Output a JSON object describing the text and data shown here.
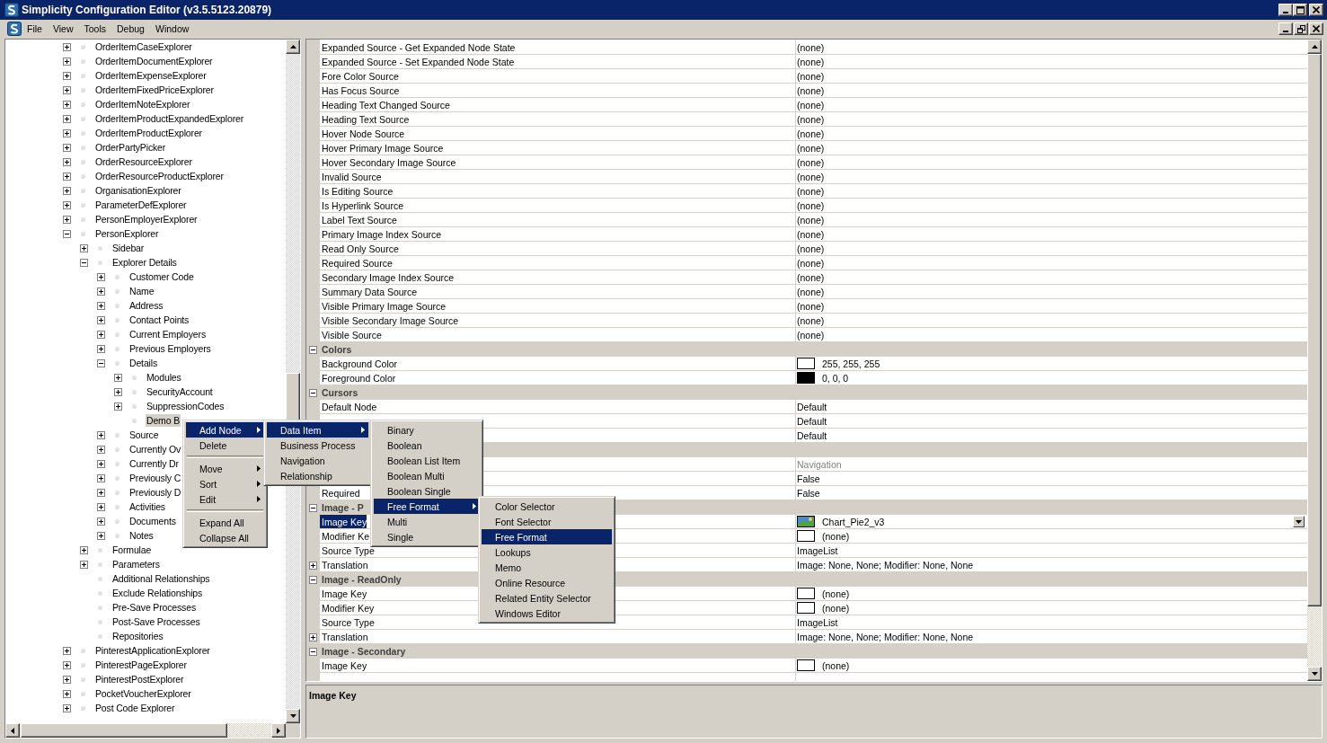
{
  "window": {
    "title": "Simplicity Configuration Editor (v3.5.5123.20879)"
  },
  "menu_bar": {
    "items": [
      "File",
      "View",
      "Tools",
      "Debug",
      "Window"
    ]
  },
  "tree": {
    "items": [
      {
        "label": "OrderItemCaseExplorer",
        "expanded": false,
        "selected": false
      },
      {
        "label": "OrderItemDocumentExplorer",
        "expanded": false,
        "selected": false
      },
      {
        "label": "OrderItemExpenseExplorer",
        "expanded": false,
        "selected": false
      },
      {
        "label": "OrderItemFixedPriceExplorer",
        "expanded": false,
        "selected": false
      },
      {
        "label": "OrderItemNoteExplorer",
        "expanded": false,
        "selected": false
      },
      {
        "label": "OrderItemProductExpandedExplorer",
        "expanded": false,
        "selected": false
      },
      {
        "label": "OrderItemProductExplorer",
        "expanded": false,
        "selected": false
      },
      {
        "label": "OrderPartyPicker",
        "expanded": false,
        "selected": false
      },
      {
        "label": "OrderResourceExplorer",
        "expanded": false,
        "selected": false
      },
      {
        "label": "OrderResourceProductExplorer",
        "expanded": false,
        "selected": false
      },
      {
        "label": "OrganisationExplorer",
        "expanded": false,
        "selected": false
      },
      {
        "label": "ParameterDefExplorer",
        "expanded": false,
        "selected": false
      },
      {
        "label": "PersonEmployerExplorer",
        "expanded": false,
        "selected": false
      },
      {
        "label": "PersonExplorer",
        "expanded": true,
        "selected": false,
        "children": [
          {
            "label": "Sidebar",
            "expanded": false,
            "selected": false
          },
          {
            "label": "Explorer Details",
            "expanded": true,
            "selected": false,
            "children": [
              {
                "label": "Customer Code",
                "expanded": false,
                "selected": false
              },
              {
                "label": "Name",
                "expanded": false,
                "selected": false
              },
              {
                "label": "Address",
                "expanded": false,
                "selected": false
              },
              {
                "label": "Contact Points",
                "expanded": false,
                "selected": false
              },
              {
                "label": "Current Employers",
                "expanded": false,
                "selected": false
              },
              {
                "label": "Previous Employers",
                "expanded": false,
                "selected": false
              },
              {
                "label": "Details",
                "expanded": true,
                "selected": false,
                "children": [
                  {
                    "label": "Modules",
                    "expanded": false,
                    "selected": false
                  },
                  {
                    "label": "SecurityAccount",
                    "expanded": false,
                    "selected": false
                  },
                  {
                    "label": "SuppressionCodes",
                    "expanded": false,
                    "selected": false
                  },
                  {
                    "label": "Demo B",
                    "selected": true
                  }
                ]
              },
              {
                "label": "Source",
                "expanded": false,
                "selected": false
              },
              {
                "label": "Currently Ov",
                "expanded": false,
                "selected": false
              },
              {
                "label": "Currently Dr",
                "expanded": false,
                "selected": false
              },
              {
                "label": "Previously C",
                "expanded": false,
                "selected": false
              },
              {
                "label": "Previously D",
                "expanded": false,
                "selected": false
              },
              {
                "label": "Activities",
                "expanded": false,
                "selected": false
              },
              {
                "label": "Documents",
                "expanded": false,
                "selected": false
              },
              {
                "label": "Notes",
                "expanded": false,
                "selected": false
              }
            ]
          },
          {
            "label": "Formulae",
            "expanded": false,
            "selected": false
          },
          {
            "label": "Parameters",
            "expanded": false,
            "selected": false
          },
          {
            "label": "Additional Relationships",
            "selected": false
          },
          {
            "label": "Exclude Relationships",
            "selected": false
          },
          {
            "label": "Pre-Save Processes",
            "selected": false
          },
          {
            "label": "Post-Save Processes",
            "selected": false
          },
          {
            "label": "Repositories",
            "selected": false
          }
        ]
      },
      {
        "label": "PinterestApplicationExplorer",
        "expanded": false,
        "selected": false
      },
      {
        "label": "PinterestPageExplorer",
        "expanded": false,
        "selected": false
      },
      {
        "label": "PinterestPostExplorer",
        "expanded": false,
        "selected": false
      },
      {
        "label": "PocketVoucherExplorer",
        "expanded": false,
        "selected": false
      },
      {
        "label": "Post Code Explorer",
        "expanded": false,
        "selected": false
      }
    ]
  },
  "property_grid": {
    "rows": [
      {
        "kind": "property",
        "name": "Expanded Source - Get Expanded Node State",
        "value": "(none)",
        "selected": false
      },
      {
        "kind": "property",
        "name": "Expanded Source - Set Expanded Node State",
        "value": "(none)",
        "selected": false
      },
      {
        "kind": "property",
        "name": "Fore Color Source",
        "value": "(none)",
        "selected": false
      },
      {
        "kind": "property",
        "name": "Has Focus Source",
        "value": "(none)",
        "selected": false
      },
      {
        "kind": "property",
        "name": "Heading Text Changed Source",
        "value": "(none)",
        "selected": false
      },
      {
        "kind": "property",
        "name": "Heading Text Source",
        "value": "(none)",
        "selected": false
      },
      {
        "kind": "property",
        "name": "Hover Node Source",
        "value": "(none)",
        "selected": false
      },
      {
        "kind": "property",
        "name": "Hover Primary Image Source",
        "value": "(none)",
        "selected": false
      },
      {
        "kind": "property",
        "name": "Hover Secondary Image Source",
        "value": "(none)",
        "selected": false
      },
      {
        "kind": "property",
        "name": "Invalid Source",
        "value": "(none)",
        "selected": false
      },
      {
        "kind": "property",
        "name": "Is Editing Source",
        "value": "(none)",
        "selected": false
      },
      {
        "kind": "property",
        "name": "Is Hyperlink Source",
        "value": "(none)",
        "selected": false
      },
      {
        "kind": "property",
        "name": "Label Text Source",
        "value": "(none)",
        "selected": false
      },
      {
        "kind": "property",
        "name": "Primary Image Index Source",
        "value": "(none)",
        "selected": false
      },
      {
        "kind": "property",
        "name": "Read Only Source",
        "value": "(none)",
        "selected": false
      },
      {
        "kind": "property",
        "name": "Required Source",
        "value": "(none)",
        "selected": false
      },
      {
        "kind": "property",
        "name": "Secondary Image Index Source",
        "value": "(none)",
        "selected": false
      },
      {
        "kind": "property",
        "name": "Summary Data Source",
        "value": "(none)",
        "selected": false
      },
      {
        "kind": "property",
        "name": "Visible Primary Image Source",
        "value": "(none)",
        "selected": false
      },
      {
        "kind": "property",
        "name": "Visible Secondary Image Source",
        "value": "(none)",
        "selected": false
      },
      {
        "kind": "property",
        "name": "Visible Source",
        "value": "(none)",
        "selected": false
      },
      {
        "kind": "category",
        "name": "Colors",
        "expanded": true
      },
      {
        "kind": "color_property",
        "name": "Background Color",
        "value": "255, 255, 255",
        "color": "#ffffff",
        "selected": false
      },
      {
        "kind": "color_property",
        "name": "Foreground Color",
        "value": "0, 0, 0",
        "color": "#000000",
        "selected": false
      },
      {
        "kind": "category",
        "name": "Cursors",
        "expanded": true
      },
      {
        "kind": "property",
        "name": "Default Node",
        "value": "Default",
        "selected": false
      },
      {
        "kind": "property",
        "value": "Default",
        "selected": false
      },
      {
        "kind": "property",
        "value": "Default",
        "selected": false
      },
      {
        "kind": "category"
      },
      {
        "kind": "property",
        "value": "Navigation",
        "dimmed": true,
        "selected": false
      },
      {
        "kind": "property",
        "value": "False",
        "selected": false
      },
      {
        "kind": "property",
        "name": "Required",
        "value": "False",
        "selected": false
      },
      {
        "kind": "category",
        "name": "Image - P",
        "expanded": true
      },
      {
        "kind": "image_property",
        "name": "Image Key",
        "value": "Chart_Pie2_v3",
        "dropdown": true,
        "selected": true
      },
      {
        "kind": "empty_image_property",
        "name": "Modifier Ke",
        "value": "(none)",
        "selected": false
      },
      {
        "kind": "property",
        "name": "Source Type",
        "value": "ImageList",
        "selected": false
      },
      {
        "kind": "property",
        "name": "Translation",
        "value": "Image: None, None; Modifier: None, None",
        "expanded": false,
        "selected": false
      },
      {
        "kind": "category",
        "name": "Image - ReadOnly",
        "expanded": true
      },
      {
        "kind": "empty_image_property",
        "name": "Image Key",
        "value": "(none)",
        "selected": false
      },
      {
        "kind": "empty_image_property",
        "name": "Modifier Key",
        "value": "(none)",
        "selected": false
      },
      {
        "kind": "property",
        "name": "Source Type",
        "value": "ImageList",
        "selected": false
      },
      {
        "kind": "property",
        "name": "Translation",
        "value": "Image: None, None; Modifier: None, None",
        "expanded": false,
        "selected": false
      },
      {
        "kind": "category",
        "name": "Image - Secondary",
        "expanded": true
      },
      {
        "kind": "empty_image_property",
        "name": "Image Key",
        "value": "(none)",
        "selected": false
      }
    ]
  },
  "description": {
    "title": "Image Key"
  },
  "context_menus": [
    {
      "items": [
        {
          "kind": "item",
          "label": "Add Node",
          "submenu": true,
          "selected": true
        },
        {
          "kind": "item",
          "label": "Delete",
          "submenu": false,
          "selected": false
        },
        {
          "kind": "separator"
        },
        {
          "kind": "item",
          "label": "Move",
          "submenu": true,
          "selected": false
        },
        {
          "kind": "item",
          "label": "Sort",
          "submenu": true,
          "selected": false
        },
        {
          "kind": "item",
          "label": "Edit",
          "submenu": true,
          "selected": false
        },
        {
          "kind": "separator"
        },
        {
          "kind": "item",
          "label": "Expand All",
          "submenu": false,
          "selected": false
        },
        {
          "kind": "item",
          "label": "Collapse All",
          "submenu": false,
          "selected": false
        }
      ]
    },
    {
      "items": [
        {
          "kind": "item",
          "label": "Data Item",
          "submenu": true,
          "selected": true
        },
        {
          "kind": "item",
          "label": "Business Process",
          "submenu": false,
          "selected": false
        },
        {
          "kind": "item",
          "label": "Navigation",
          "submenu": false,
          "selected": false
        },
        {
          "kind": "item",
          "label": "Relationship",
          "submenu": false,
          "selected": false
        }
      ]
    },
    {
      "items": [
        {
          "kind": "item",
          "label": "Binary",
          "submenu": false,
          "selected": false
        },
        {
          "kind": "item",
          "label": "Boolean",
          "submenu": false,
          "selected": false
        },
        {
          "kind": "item",
          "label": "Boolean List Item",
          "submenu": false,
          "selected": false
        },
        {
          "kind": "item",
          "label": "Boolean Multi",
          "submenu": false,
          "selected": false
        },
        {
          "kind": "item",
          "label": "Boolean Single",
          "submenu": false,
          "selected": false
        },
        {
          "kind": "item",
          "label": "Free Format",
          "submenu": true,
          "selected": true
        },
        {
          "kind": "item",
          "label": "Multi",
          "submenu": false,
          "selected": false
        },
        {
          "kind": "item",
          "label": "Single",
          "submenu": false,
          "selected": false
        }
      ]
    },
    {
      "items": [
        {
          "kind": "item",
          "label": "Color Selector",
          "submenu": false,
          "selected": false
        },
        {
          "kind": "item",
          "label": "Font Selector",
          "submenu": false,
          "selected": false
        },
        {
          "kind": "item",
          "label": "Free Format",
          "submenu": false,
          "selected": true
        },
        {
          "kind": "item",
          "label": "Lookups",
          "submenu": false,
          "selected": false
        },
        {
          "kind": "item",
          "label": "Memo",
          "submenu": false,
          "selected": false
        },
        {
          "kind": "item",
          "label": "Online Resource",
          "submenu": false,
          "selected": false
        },
        {
          "kind": "item",
          "label": "Related Entity Selector",
          "submenu": false,
          "selected": false
        },
        {
          "kind": "item",
          "label": "Windows Editor",
          "submenu": false,
          "selected": false
        }
      ]
    }
  ]
}
